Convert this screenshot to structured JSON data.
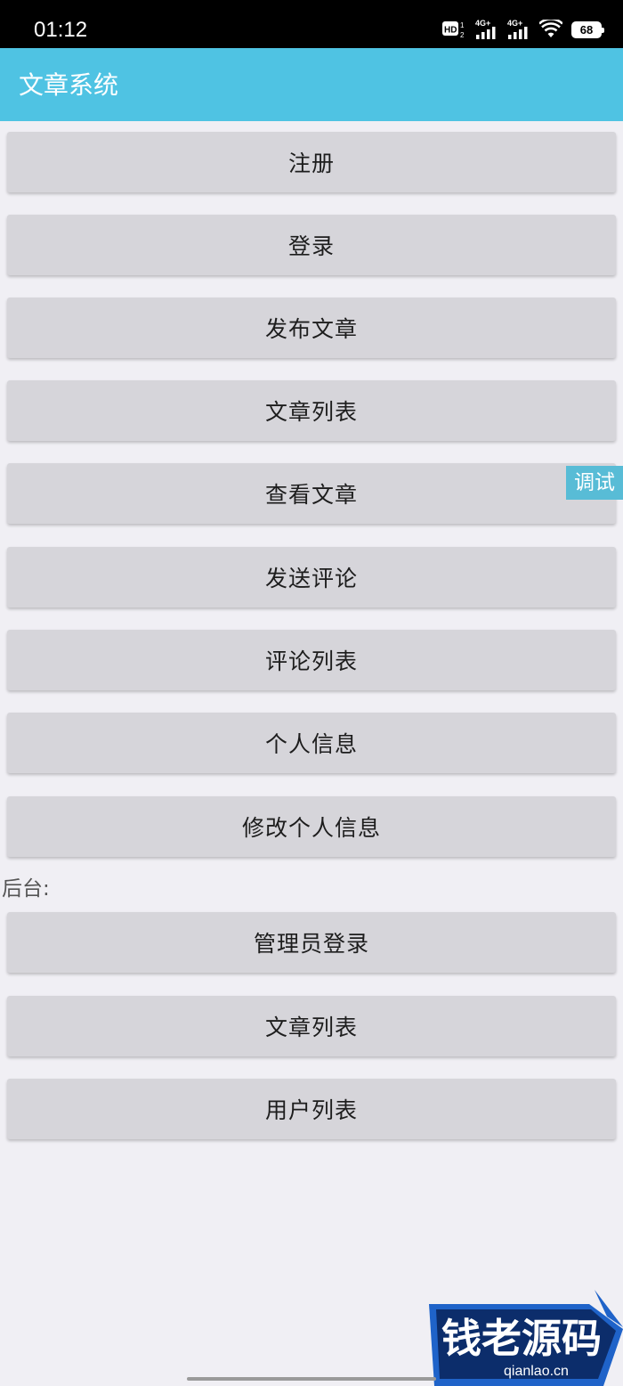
{
  "status_bar": {
    "time": "01:12",
    "battery_level": "68",
    "network_1": "4G+",
    "network_2": "4G+",
    "hd_label": "HD"
  },
  "app_bar": {
    "title": "文章系统",
    "color": "#4fc3e3"
  },
  "buttons": [
    {
      "label": "注册"
    },
    {
      "label": "登录"
    },
    {
      "label": "发布文章"
    },
    {
      "label": "文章列表"
    },
    {
      "label": "查看文章"
    },
    {
      "label": "发送评论"
    },
    {
      "label": "评论列表"
    },
    {
      "label": "个人信息"
    },
    {
      "label": "修改个人信息"
    }
  ],
  "admin_section": {
    "label": "后台:",
    "buttons": [
      {
        "label": "管理员登录"
      },
      {
        "label": "文章列表"
      },
      {
        "label": "用户列表"
      }
    ]
  },
  "debug_tab": {
    "label": "调试"
  },
  "watermark": {
    "title": "钱老源码",
    "url": "qianlao.cn"
  }
}
